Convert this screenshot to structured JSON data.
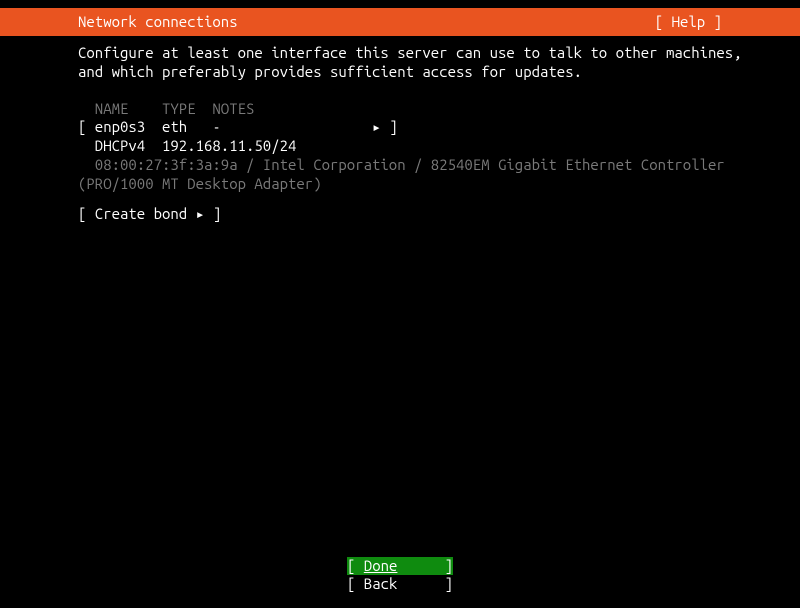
{
  "header": {
    "title": "Network connections",
    "help": "[ Help ]"
  },
  "description": "Configure at least one interface this server can use to talk to other machines,\nand which preferably provides sufficient access for updates.",
  "table": {
    "headers": "  NAME    TYPE  NOTES",
    "interface_row": "[ enp0s3  eth   -                  ▸ ]",
    "dhcp_row": "  DHCPv4  192.168.11.50/24",
    "hw_info": "  08:00:27:3f:3a:9a / Intel Corporation / 82540EM Gigabit Ethernet Controller\n(PRO/1000 MT Desktop Adapter)"
  },
  "create_bond": "[ Create bond ▸ ]",
  "buttons": {
    "done_left": "[ ",
    "done_label": "Done",
    "done_right": "  ]",
    "back_left": "[ ",
    "back_label": "Back",
    "back_right": "  ]"
  }
}
